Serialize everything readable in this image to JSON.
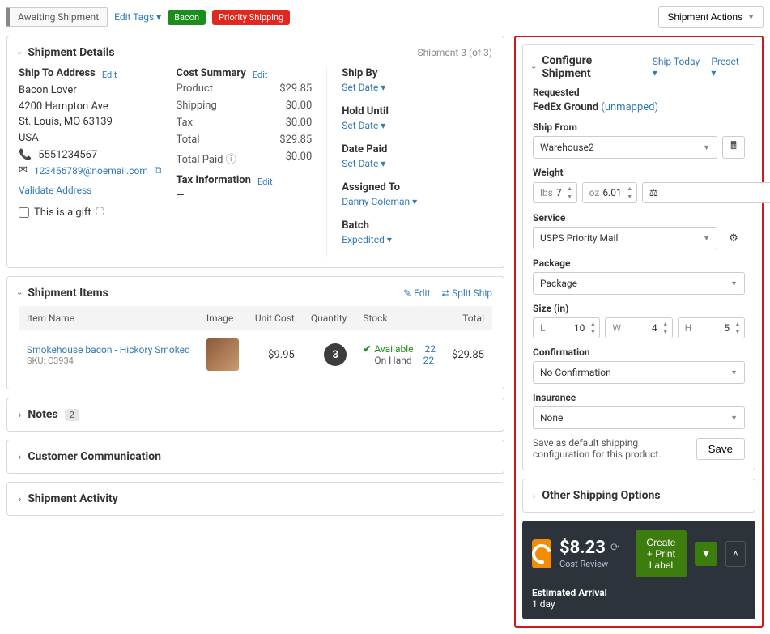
{
  "topbar": {
    "status": "Awaiting Shipment",
    "edit_tags": "Edit Tags ▾",
    "tags": {
      "bacon": "Bacon",
      "priority": "Priority Shipping"
    },
    "actions": "Shipment Actions"
  },
  "details": {
    "title": "Shipment Details",
    "counter": "Shipment 3 (of 3)",
    "shipto": {
      "label": "Ship To Address",
      "edit": "Edit",
      "name": "Bacon Lover",
      "street": "4200 Hampton Ave",
      "city": "St. Louis, MO 63139",
      "country": "USA",
      "phone": "5551234567",
      "email": "123456789@noemail.com",
      "validate": "Validate Address",
      "gift_label": "This is a gift"
    },
    "cost": {
      "label": "Cost Summary",
      "edit": "Edit",
      "product_l": "Product",
      "product_v": "$29.85",
      "shipping_l": "Shipping",
      "shipping_v": "$0.00",
      "tax_l": "Tax",
      "tax_v": "$0.00",
      "total_l": "Total",
      "total_v": "$29.85",
      "paid_l": "Total Paid",
      "paid_v": "$0.00",
      "taxinfo_l": "Tax Information",
      "taxinfo_edit": "Edit",
      "taxinfo_v": "—"
    },
    "shipby": {
      "label": "Ship By",
      "value": "Set Date ▾"
    },
    "holduntil": {
      "label": "Hold Until",
      "value": "Set Date ▾"
    },
    "datepaid": {
      "label": "Date Paid",
      "value": "Set Date ▾"
    },
    "assigned": {
      "label": "Assigned To",
      "value": "Danny Coleman ▾"
    },
    "batch": {
      "label": "Batch",
      "value": "Expedited ▾"
    }
  },
  "items": {
    "title": "Shipment Items",
    "edit": "Edit",
    "split": "Split Ship",
    "cols": {
      "name": "Item Name",
      "image": "Image",
      "cost": "Unit Cost",
      "qty": "Quantity",
      "stock": "Stock",
      "total": "Total"
    },
    "row": {
      "name": "Smokehouse bacon - Hickory Smoked",
      "sku": "SKU: C3934",
      "cost": "$9.95",
      "qty": "3",
      "available_l": "Available",
      "available_v": "22",
      "onhand_l": "On Hand",
      "onhand_v": "22",
      "total": "$29.85"
    }
  },
  "notes": {
    "title": "Notes",
    "count": "2"
  },
  "comm": {
    "title": "Customer Communication"
  },
  "activity": {
    "title": "Shipment Activity"
  },
  "config": {
    "title": "Configure Shipment",
    "ship_today": "Ship Today ▾",
    "preset": "Preset  ▾",
    "requested_l": "Requested",
    "requested_carrier": "FedEx Ground",
    "unmapped": "(unmapped)",
    "shipfrom_l": "Ship From",
    "shipfrom_v": "Warehouse2",
    "weight_l": "Weight",
    "lbs_unit": "lbs",
    "lbs_val": "7",
    "oz_unit": "oz",
    "oz_val": "6.01",
    "scale": "Scale",
    "service_l": "Service",
    "service_v": "USPS Priority Mail",
    "package_l": "Package",
    "package_v": "Package",
    "size_l": "Size (in)",
    "size_l_unit": "L",
    "size_l_val": "10",
    "size_w_unit": "W",
    "size_w_val": "4",
    "size_h_unit": "H",
    "size_h_val": "5",
    "confirm_l": "Confirmation",
    "confirm_v": "No Confirmation",
    "insurance_l": "Insurance",
    "insurance_v": "None",
    "save_text": "Save as default shipping configuration for this product.",
    "save_btn": "Save"
  },
  "other": {
    "title": "Other Shipping Options"
  },
  "rate": {
    "price": "$8.23",
    "cost_review": "Cost Review",
    "create": "Create + Print Label",
    "eta_l": "Estimated Arrival",
    "eta_v": "1 day"
  }
}
